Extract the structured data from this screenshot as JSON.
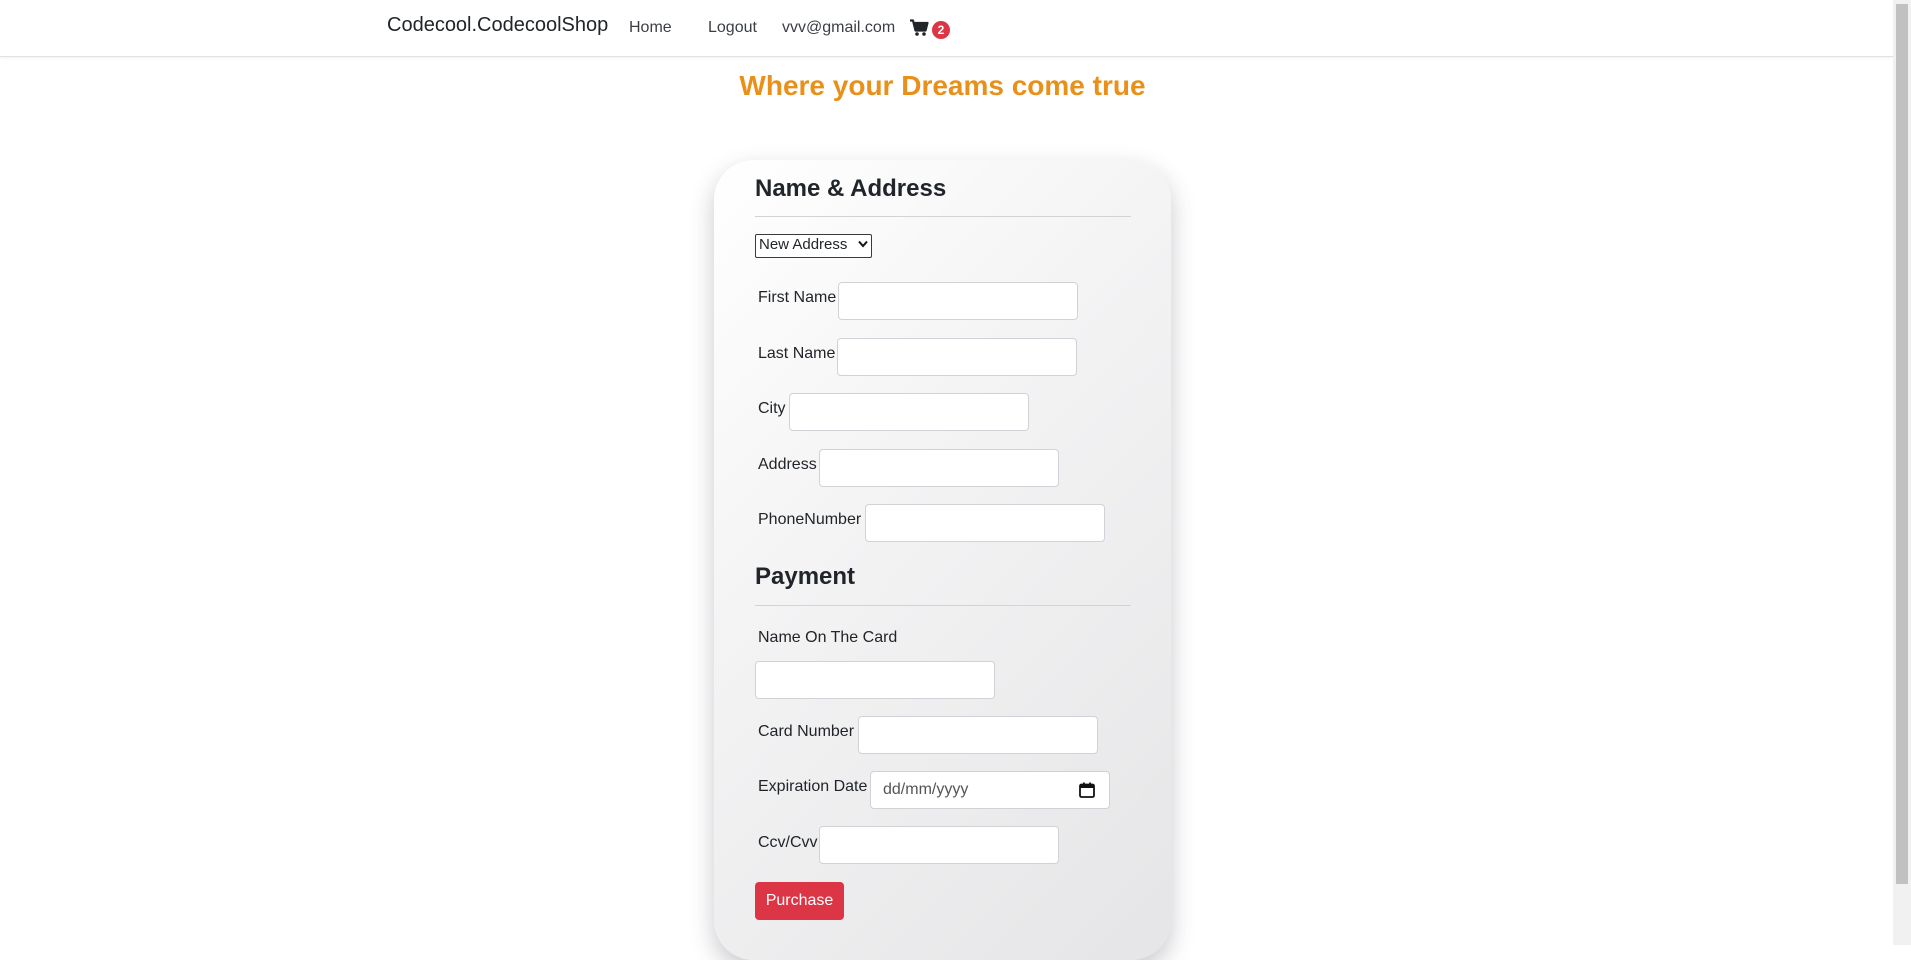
{
  "navbar": {
    "brand": "Codecool.CodecoolShop",
    "home_label": "Home",
    "logout_label": "Logout",
    "user_email": "vvv@gmail.com",
    "cart_count": "2"
  },
  "header": {
    "tagline": "Where your Dreams come true"
  },
  "address_section": {
    "title": "Name & Address",
    "address_select": {
      "selected": "New Address"
    },
    "fields": {
      "first_name_label": "First Name",
      "last_name_label": "Last Name",
      "city_label": "City",
      "address_label": "Address",
      "phone_label": "PhoneNumber"
    }
  },
  "payment_section": {
    "title": "Payment",
    "fields": {
      "name_on_card_label": "Name On The Card",
      "card_number_label": "Card Number",
      "expiration_label": "Expiration Date",
      "expiration_placeholder": "dd/mm/yyyy",
      "cvv_label": "Ccv/Cvv"
    },
    "purchase_label": "Purchase"
  },
  "colors": {
    "tagline": "#e8901a",
    "purchase_button": "#dc3545",
    "cart_badge": "#dc3545"
  },
  "icons": [
    "shopping-cart-icon",
    "chevron-down-icon",
    "calendar-icon"
  ]
}
